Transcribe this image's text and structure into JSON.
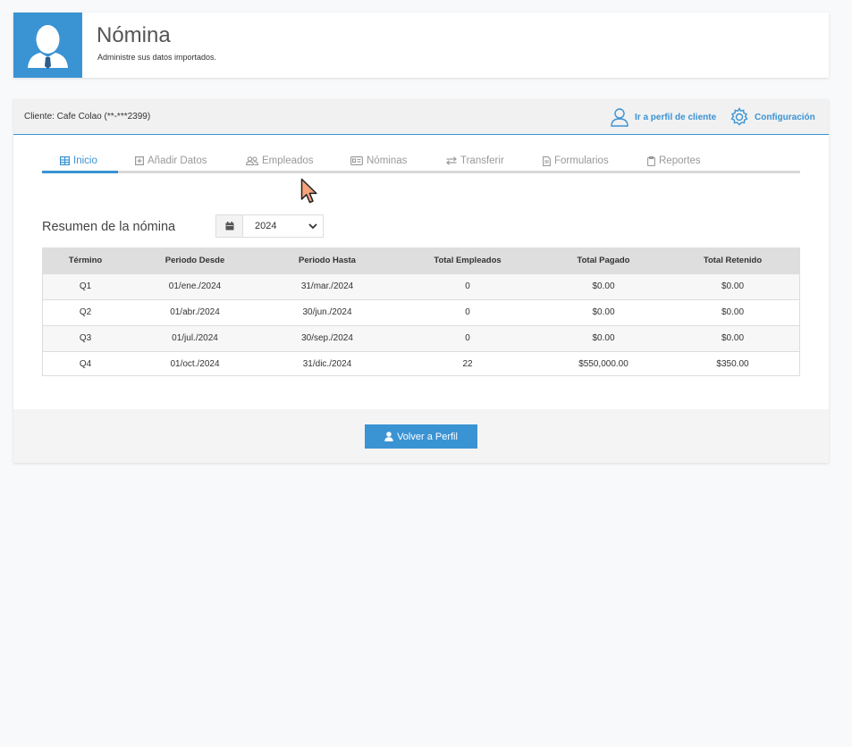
{
  "header": {
    "title": "Nómina",
    "subtitle": "Administre sus datos importados."
  },
  "client_bar": {
    "client_label": "Cliente: Cafe Colao (**-***2399)",
    "profile_link": "Ir a perfil de cliente",
    "settings_link": "Configuración"
  },
  "tabs": [
    {
      "label": "Inicio",
      "icon": "table-icon",
      "active": true
    },
    {
      "label": "Añadir Datos",
      "icon": "plus-square-icon",
      "active": false
    },
    {
      "label": "Empleados",
      "icon": "users-icon",
      "active": false
    },
    {
      "label": "Nóminas",
      "icon": "id-card-icon",
      "active": false
    },
    {
      "label": "Transferir",
      "icon": "exchange-icon",
      "active": false
    },
    {
      "label": "Formularios",
      "icon": "file-icon",
      "active": false
    },
    {
      "label": "Reportes",
      "icon": "clipboard-icon",
      "active": false
    }
  ],
  "summary": {
    "title": "Resumen de la nómina",
    "year_selected": "2024"
  },
  "table": {
    "headers": [
      "Término",
      "Periodo Desde",
      "Periodo Hasta",
      "Total Empleados",
      "Total Pagado",
      "Total Retenido"
    ],
    "rows": [
      [
        "Q1",
        "01/ene./2024",
        "31/mar./2024",
        "0",
        "$0.00",
        "$0.00"
      ],
      [
        "Q2",
        "01/abr./2024",
        "30/jun./2024",
        "0",
        "$0.00",
        "$0.00"
      ],
      [
        "Q3",
        "01/jul./2024",
        "30/sep./2024",
        "0",
        "$0.00",
        "$0.00"
      ],
      [
        "Q4",
        "01/oct./2024",
        "31/dic./2024",
        "22",
        "$550,000.00",
        "$350.00"
      ]
    ]
  },
  "footer": {
    "back_button": "Volver a Perfil"
  },
  "colors": {
    "accent": "#3a93d3",
    "cursor": "#f4a37c"
  }
}
